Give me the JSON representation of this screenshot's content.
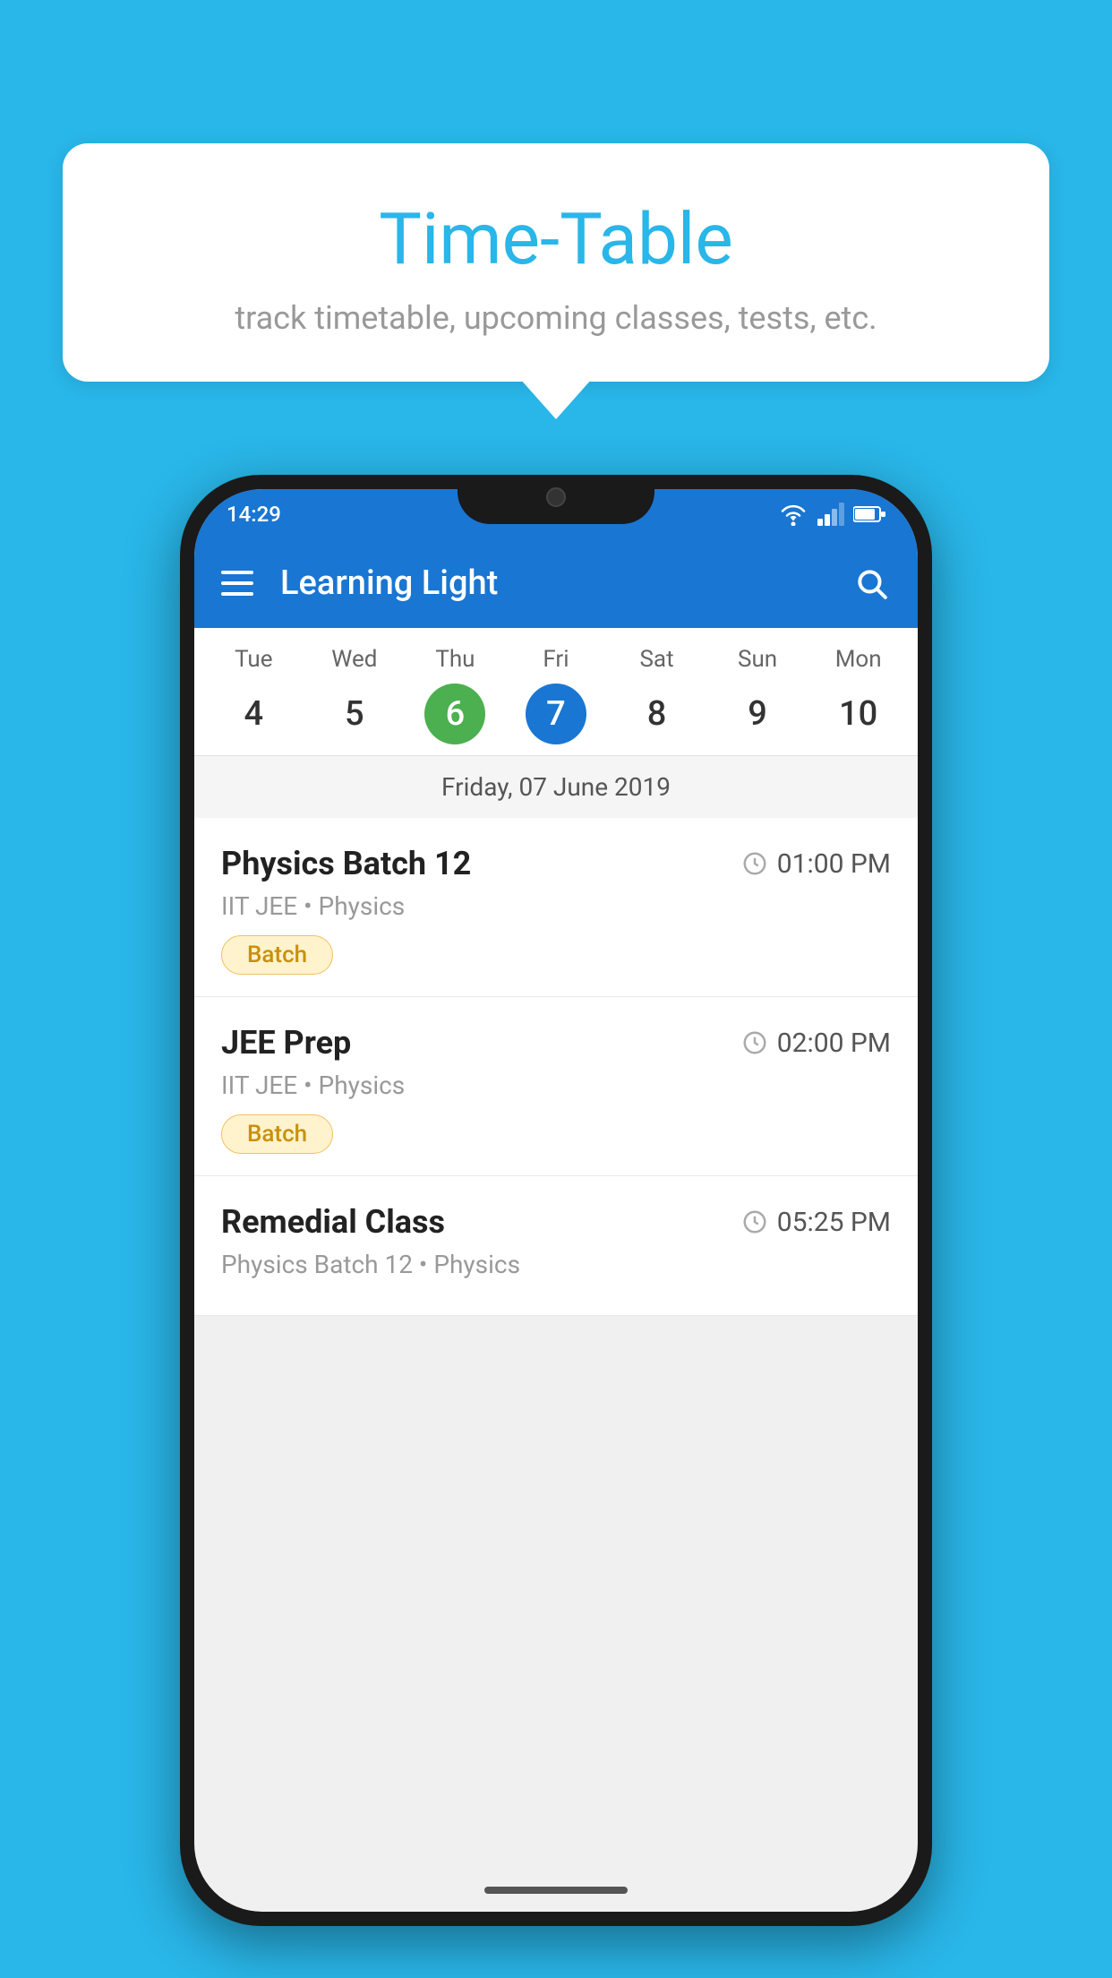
{
  "background_color": "#29b6e8",
  "tooltip": {
    "title": "Time-Table",
    "subtitle": "track timetable, upcoming classes, tests, etc."
  },
  "phone": {
    "status_bar": {
      "time": "14:29"
    },
    "app_bar": {
      "title": "Learning Light"
    },
    "calendar": {
      "days": [
        {
          "label": "Tue",
          "number": "4",
          "state": "normal"
        },
        {
          "label": "Wed",
          "number": "5",
          "state": "normal"
        },
        {
          "label": "Thu",
          "number": "6",
          "state": "today"
        },
        {
          "label": "Fri",
          "number": "7",
          "state": "selected"
        },
        {
          "label": "Sat",
          "number": "8",
          "state": "normal"
        },
        {
          "label": "Sun",
          "number": "9",
          "state": "normal"
        },
        {
          "label": "Mon",
          "number": "10",
          "state": "normal"
        }
      ],
      "selected_date_label": "Friday, 07 June 2019"
    },
    "schedule_items": [
      {
        "title": "Physics Batch 12",
        "time": "01:00 PM",
        "subtitle": "IIT JEE • Physics",
        "badge": "Batch"
      },
      {
        "title": "JEE Prep",
        "time": "02:00 PM",
        "subtitle": "IIT JEE • Physics",
        "badge": "Batch"
      },
      {
        "title": "Remedial Class",
        "time": "05:25 PM",
        "subtitle": "Physics Batch 12 • Physics",
        "badge": null
      }
    ]
  }
}
